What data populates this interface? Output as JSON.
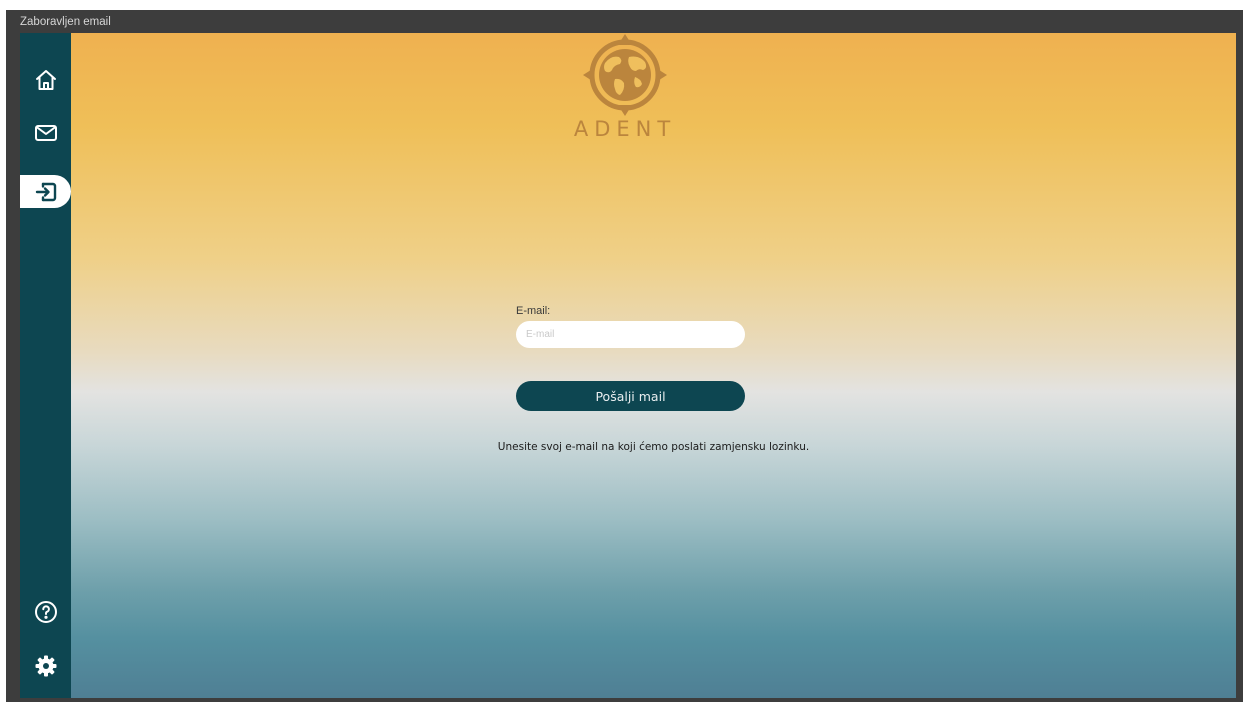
{
  "window": {
    "title": "Zaboravljen email"
  },
  "sidebar": {
    "items": [
      {
        "icon": "home-icon"
      },
      {
        "icon": "mail-icon"
      },
      {
        "icon": "login-icon",
        "active": true
      },
      {
        "icon": "help-icon"
      },
      {
        "icon": "gear-icon"
      }
    ]
  },
  "logo": {
    "text": "ADENT"
  },
  "form": {
    "email_label": "E-mail:",
    "email_placeholder": "E-mail",
    "email_value": "",
    "send_label": "Pošalji mail"
  },
  "info": {
    "text": "Unesite svoj e-mail na koji ćemo poslati zamjensku lozinku."
  },
  "colors": {
    "sidebar_bg": "#0d4651",
    "button_bg": "#0d4651",
    "logo_gold": "#bb853d",
    "frame_bg": "#3d3d3d"
  }
}
